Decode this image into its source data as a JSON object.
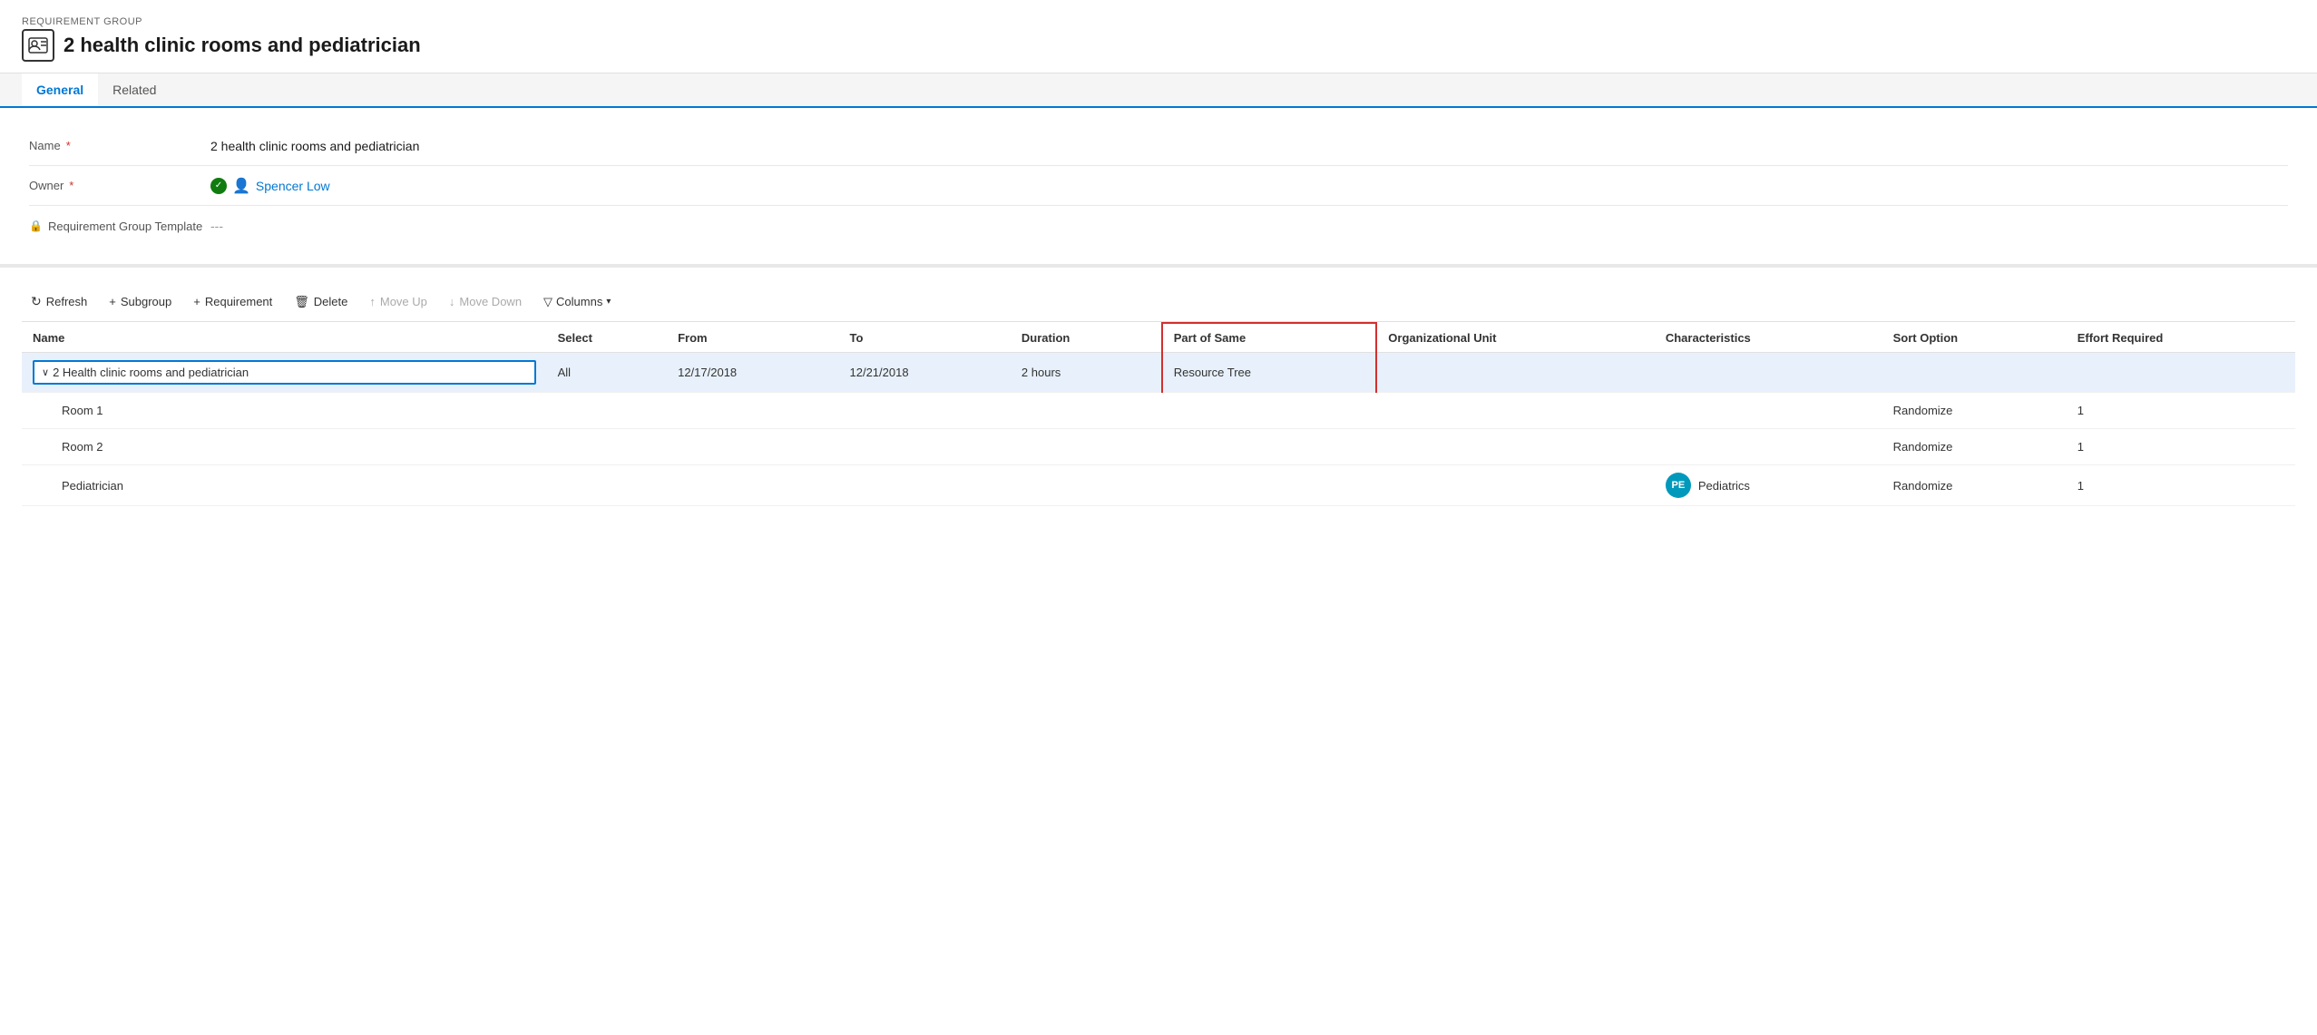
{
  "header": {
    "entity_type": "REQUIREMENT GROUP",
    "title": "2 health clinic rooms and pediatrician"
  },
  "tabs": [
    {
      "id": "general",
      "label": "General",
      "active": true
    },
    {
      "id": "related",
      "label": "Related",
      "active": false
    }
  ],
  "form": {
    "fields": [
      {
        "label": "Name",
        "required": true,
        "value": "2 health clinic rooms and pediatrician",
        "type": "text"
      },
      {
        "label": "Owner",
        "required": true,
        "value": "Spencer Low",
        "type": "owner"
      },
      {
        "label": "Requirement Group Template",
        "required": false,
        "value": "---",
        "type": "muted",
        "has_lock": true
      }
    ]
  },
  "toolbar": {
    "refresh_label": "Refresh",
    "subgroup_label": "Subgroup",
    "requirement_label": "Requirement",
    "delete_label": "Delete",
    "move_up_label": "Move Up",
    "move_down_label": "Move Down",
    "columns_label": "Columns"
  },
  "table": {
    "columns": [
      {
        "id": "name",
        "label": "Name"
      },
      {
        "id": "select",
        "label": "Select"
      },
      {
        "id": "from",
        "label": "From"
      },
      {
        "id": "to",
        "label": "To"
      },
      {
        "id": "duration",
        "label": "Duration"
      },
      {
        "id": "part_of_same",
        "label": "Part of Same",
        "highlighted": true
      },
      {
        "id": "org_unit",
        "label": "Organizational Unit"
      },
      {
        "id": "characteristics",
        "label": "Characteristics"
      },
      {
        "id": "sort_option",
        "label": "Sort Option"
      },
      {
        "id": "effort_required",
        "label": "Effort Required"
      }
    ],
    "rows": [
      {
        "name": "2 Health clinic rooms and pediatrician",
        "is_parent": true,
        "selected": true,
        "select": "All",
        "from": "12/17/2018",
        "to": "12/21/2018",
        "duration": "2 hours",
        "part_of_same": "Resource Tree",
        "org_unit": "",
        "characteristics": "",
        "sort_option": "",
        "effort_required": ""
      },
      {
        "name": "Room 1",
        "is_child": true,
        "select": "",
        "from": "",
        "to": "",
        "duration": "",
        "part_of_same": "",
        "org_unit": "",
        "characteristics": "",
        "sort_option": "Randomize",
        "effort_required": "1"
      },
      {
        "name": "Room 2",
        "is_child": true,
        "select": "",
        "from": "",
        "to": "",
        "duration": "",
        "part_of_same": "",
        "org_unit": "",
        "characteristics": "",
        "sort_option": "Randomize",
        "effort_required": "1"
      },
      {
        "name": "Pediatrician",
        "is_child": true,
        "select": "",
        "from": "",
        "to": "",
        "duration": "",
        "part_of_same": "",
        "org_unit": "",
        "characteristics_badge": "PE",
        "characteristics": "Pediatrics",
        "sort_option": "Randomize",
        "effort_required": "1"
      }
    ]
  }
}
